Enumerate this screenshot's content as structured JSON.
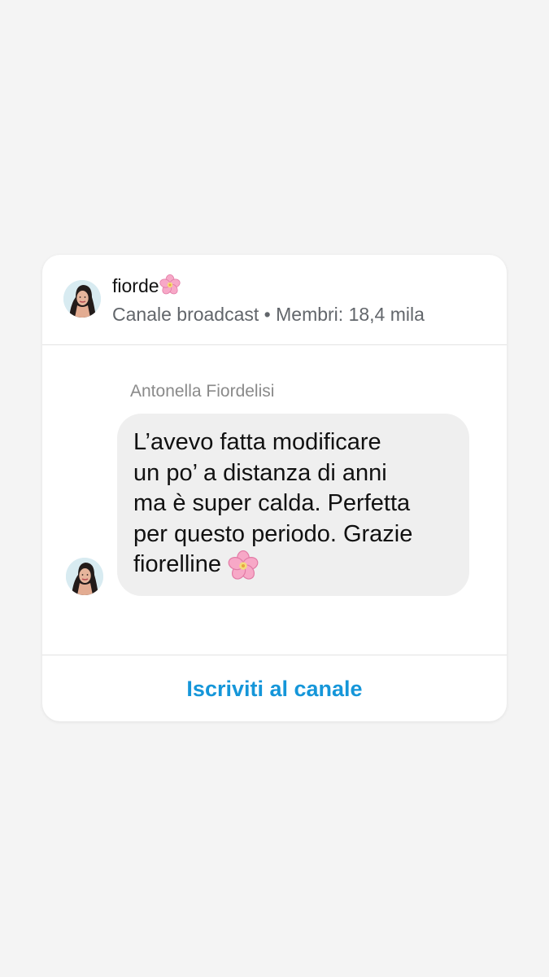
{
  "channel": {
    "name": "fiorde",
    "name_emoji_icon": "cherry-blossom-icon",
    "meta": "Canale broadcast • Membri: 18,4 mila"
  },
  "message": {
    "sender": "Antonella Fiordelisi",
    "text": "L’avevo fatta modificare\nun po’ a distanza di anni\nma è super calda. Perfetta\nper questo periodo. Grazie\nfiorelline",
    "text_emoji_icon": "cherry-blossom-icon"
  },
  "footer": {
    "subscribe_label": "Iscriviti al canale"
  },
  "colors": {
    "background": "#f4f4f4",
    "card": "#ffffff",
    "bubble": "#efefef",
    "link": "#1596d9",
    "muted_text": "#62666b"
  }
}
